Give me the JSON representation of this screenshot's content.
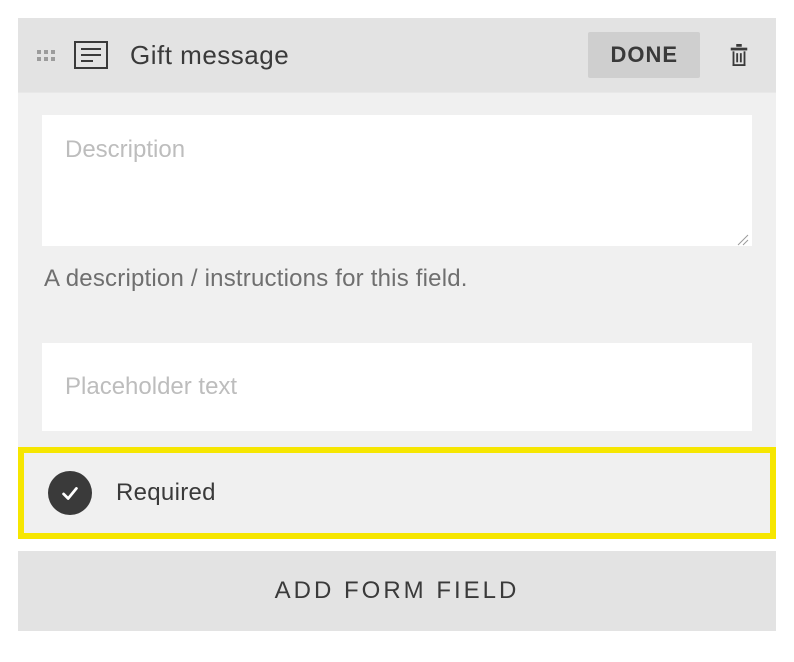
{
  "field": {
    "title": "Gift message",
    "done_label": "DONE",
    "description_placeholder": "Description",
    "description_helper": "A description / instructions for this field.",
    "placeholder_placeholder": "Placeholder text",
    "required_label": "Required",
    "required_checked": true
  },
  "actions": {
    "add_field_label": "ADD FORM FIELD"
  }
}
